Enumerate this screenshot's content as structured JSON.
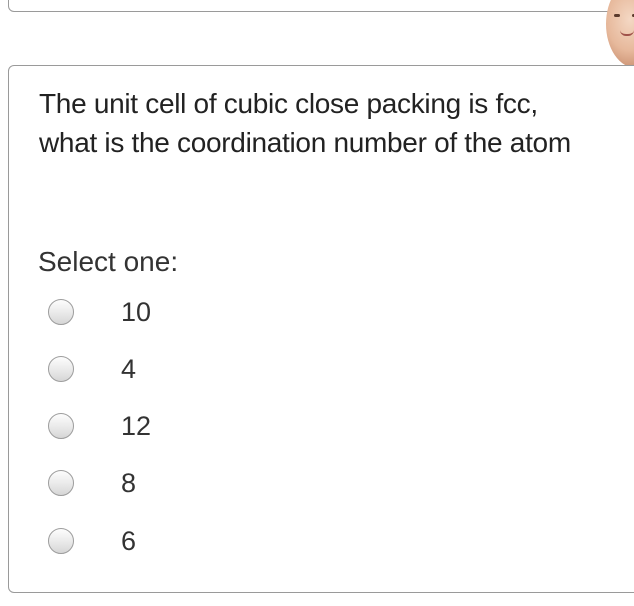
{
  "question": {
    "text": "The unit cell of cubic close packing is fcc, what is the coordination number of the atom",
    "prompt": "Select one:",
    "options": [
      {
        "label": "10"
      },
      {
        "label": "4"
      },
      {
        "label": "12"
      },
      {
        "label": "8"
      },
      {
        "label": "6"
      }
    ]
  },
  "icons": {
    "avatar": "user-avatar-icon",
    "radio": "radio-unselected-icon"
  }
}
